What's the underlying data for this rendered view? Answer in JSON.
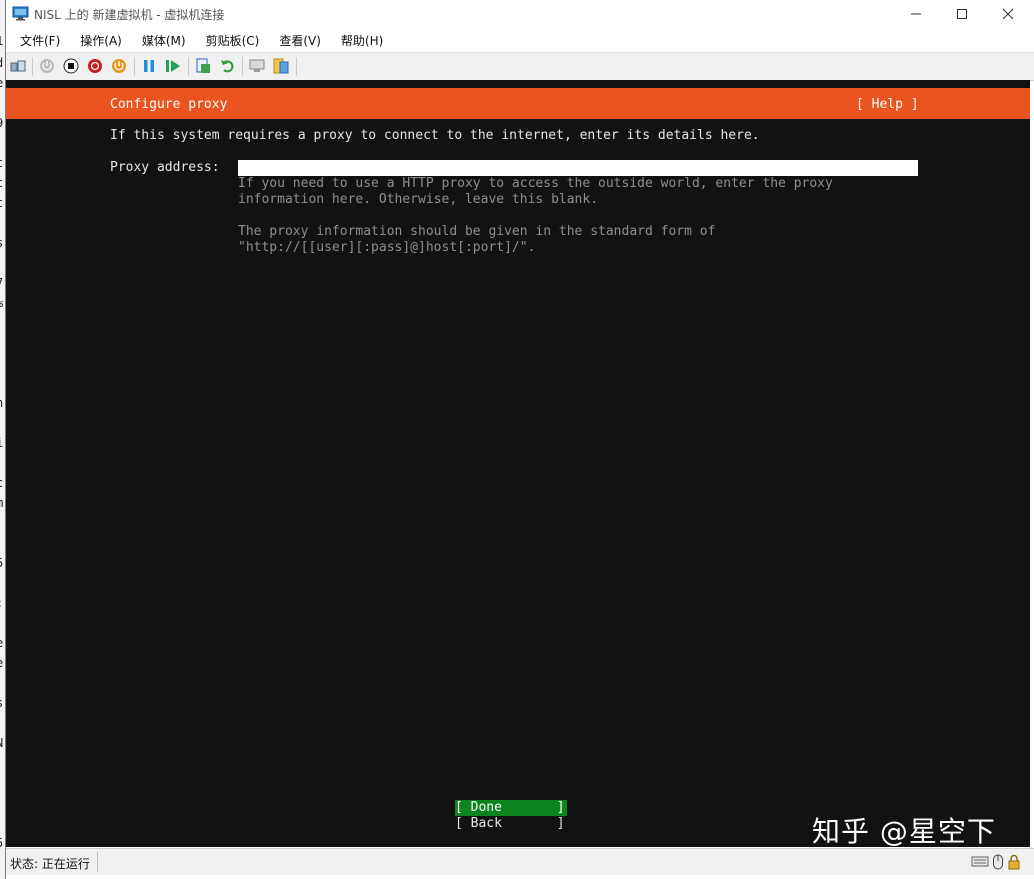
{
  "window": {
    "title": "NISL 上的 新建虚拟机 - 虚拟机连接"
  },
  "menu": {
    "items": [
      "文件(F)",
      "操作(A)",
      "媒体(M)",
      "剪贴板(C)",
      "查看(V)",
      "帮助(H)"
    ]
  },
  "toolbar": {
    "icons": [
      "ctrl-alt-del-icon",
      "start-icon",
      "turn-off-icon",
      "shutdown-icon",
      "save-icon",
      "pause-icon",
      "resume-icon",
      "checkpoint-icon",
      "revert-icon",
      "enhanced-session-icon",
      "share-icon"
    ]
  },
  "console": {
    "header_title": "Configure proxy",
    "help_label": "[ Help ]",
    "intro_text": "If this system requires a proxy to connect to the internet, enter its details here.",
    "proxy_label": "Proxy address:",
    "proxy_value": "",
    "help_text": [
      "If you need to use a HTTP proxy to access the outside world, enter the proxy",
      "information here. Otherwise, leave this blank.",
      "",
      "The proxy information should be given in the standard form of",
      "\"http://[[user][:pass]@]host[:port]/\"."
    ],
    "done_label": "[ Done       ]",
    "back_label": "[ Back       ]"
  },
  "watermark": "知乎 @星空下",
  "status": {
    "text": "状态: 正在运行"
  },
  "colors": {
    "header": "#e95420",
    "done_button": "#0e8420",
    "console_bg": "#121212"
  }
}
